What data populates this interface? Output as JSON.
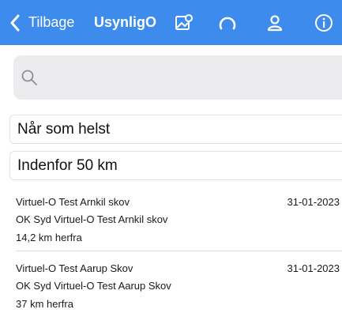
{
  "navbar": {
    "back_label": "Tilbage",
    "title": "UsynligO",
    "icons": [
      "chevron-left-icon",
      "map-pin-icon",
      "arc-progress-icon",
      "person-icon",
      "info-icon"
    ],
    "bg_color": "#3d8bec"
  },
  "search": {
    "value": "",
    "placeholder": ""
  },
  "filters": {
    "time": "Når som helst",
    "distance": "Indenfor 50 km"
  },
  "events": [
    {
      "name": "Virtuel-O Test Arnkil skov",
      "date": "31-01-2023",
      "organizer": "OK Syd Virtuel-O Test Arnkil skov",
      "distance": "14,2 km herfra"
    },
    {
      "name": "Virtuel-O Test Aarup Skov",
      "date": "31-01-2023",
      "organizer": "OK Syd Virtuel-O Test Aarup Skov",
      "distance": "37 km herfra"
    }
  ]
}
